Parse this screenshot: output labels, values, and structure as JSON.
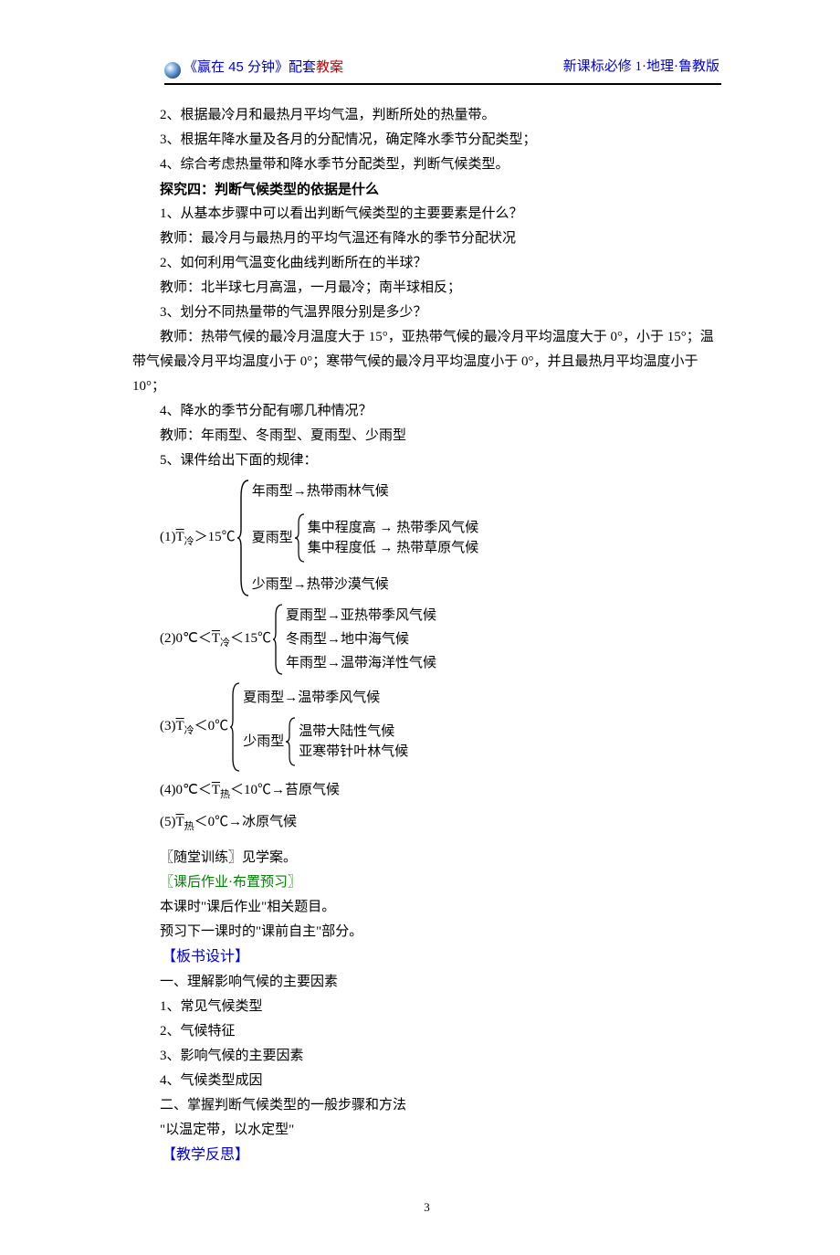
{
  "header": {
    "left_prefix": "《赢在 45 分钟》配套",
    "left_red": "教案",
    "right": "新课标必修 1·地理·鲁教版"
  },
  "body": {
    "p1": "2、根据最冷月和最热月平均气温，判断所处的热量带。",
    "p2": "3、根据年降水量及各月的分配情况，确定降水季节分配类型；",
    "p3": "4、综合考虑热量带和降水季节分配类型，判断气候类型。",
    "p4": "探究四：判断气候类型的依据是什么",
    "p5": "1、从基本步骤中可以看出判断气候类型的主要要素是什么？",
    "p6": "教师：最冷月与最热月的平均气温还有降水的季节分配状况",
    "p7": "2、如何利用气温变化曲线判断所在的半球？",
    "p8": "教师：北半球七月高温，一月最冷；南半球相反；",
    "p9": "3、划分不同热量带的气温界限分别是多少？",
    "p10": "教师：热带气候的最冷月温度大于 15°，亚热带气候的最冷月平均温度大于 0°，小于 15°；温带气候最冷月平均温度小于 0°；寒带气候的最冷月平均温度小于 0°，并且最热月平均温度小于 10°；",
    "p11": "4、降水的季节分配有哪几种情况？",
    "p12": "教师：年雨型、冬雨型、夏雨型、少雨型",
    "p13": "5、课件给出下面的规律：",
    "p14": "〖随堂训练〗见学案。",
    "p15": "〖课后作业·布置预习〗",
    "p16": "本课时\"课后作业\"相关题目。",
    "p17": "预习下一课时的\"课前自主\"部分。",
    "p18": "【板书设计】",
    "p19": "一、理解影响气候的主要因素",
    "p20": "1、常见气候类型",
    "p21": "2、气候特征",
    "p22": "3、影响气候的主要因素",
    "p23": "4、气候类型成因",
    "p24": "二、掌握判断气候类型的一般步骤和方法",
    "p25": "\"以温定带，以水定型\"",
    "p26": "【教学反思】"
  },
  "rules": {
    "r1": {
      "prefix_num": "(1)",
      "cond": "＞15℃",
      "lines": {
        "a": "年雨型→热带雨林气候",
        "b_label": "夏雨型",
        "b_hi": "集中程度高 → 热带季风气候",
        "b_lo": "集中程度低 → 热带草原气候",
        "c": "少雨型→热带沙漠气候"
      }
    },
    "r2": {
      "prefix_num": "(2)0℃＜",
      "cond": "＜15℃",
      "lines": {
        "a": "夏雨型→亚热带季风气候",
        "b": "冬雨型→地中海气候",
        "c": "年雨型→温带海洋性气候"
      }
    },
    "r3": {
      "prefix_num": "(3)",
      "cond": "＜0℃",
      "lines": {
        "a": "夏雨型→温带季风气候",
        "b_label": "少雨型",
        "b_up": "温带大陆性气候",
        "b_dn": "亚寒带针叶林气候"
      }
    },
    "r4": {
      "text_pre": "(4)0℃＜",
      "text_mid": "＜10℃→苔原气候"
    },
    "r5": {
      "text_pre": "(5)",
      "text_mid": "＜0℃→冰原气候"
    }
  },
  "sym": {
    "T": "T",
    "leng": "冷",
    "re": "热"
  },
  "page": "3"
}
